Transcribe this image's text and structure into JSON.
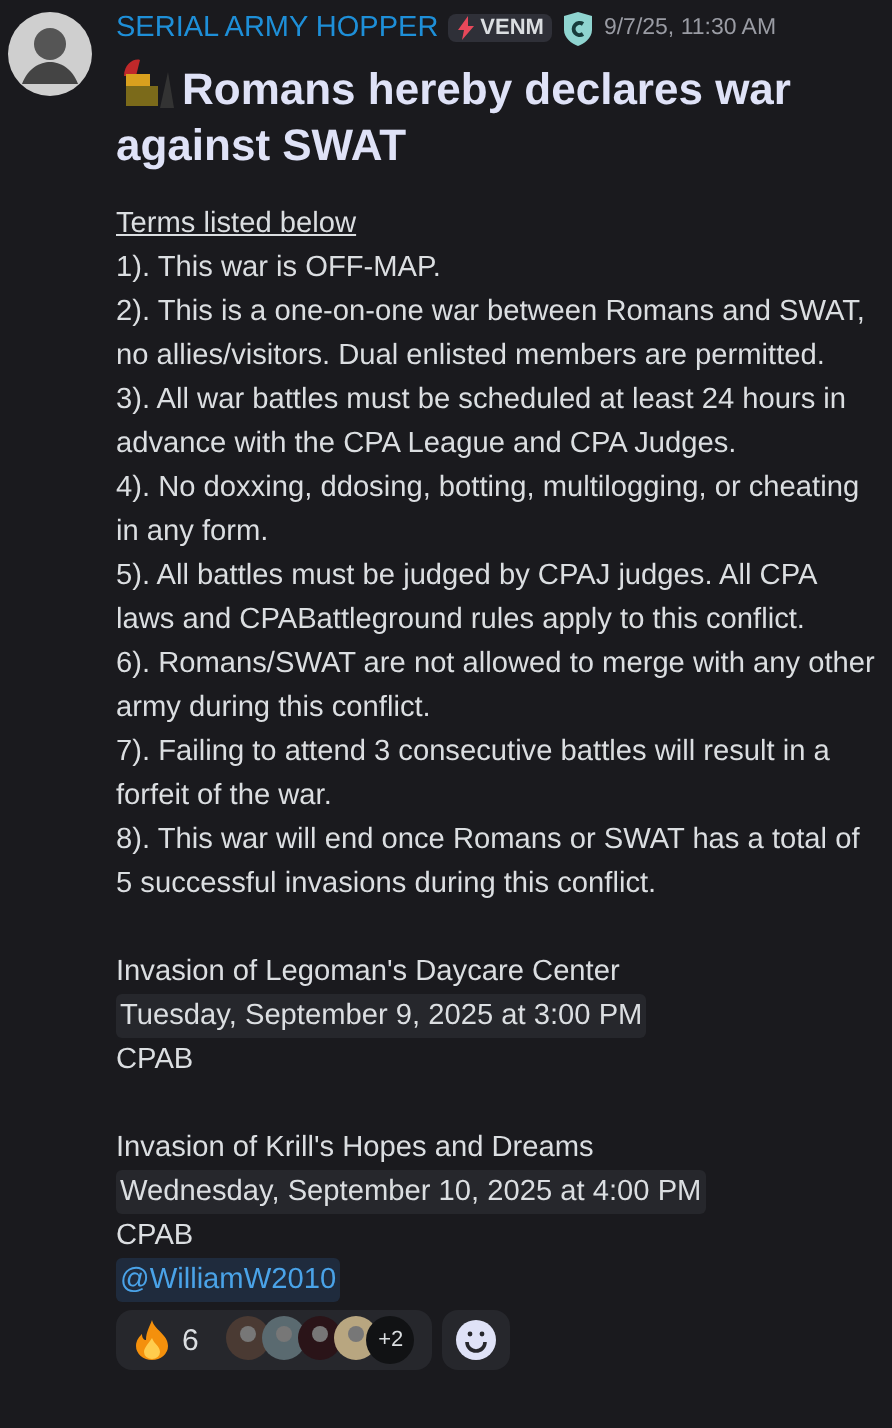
{
  "message": {
    "author": "SERIAL ARMY HOPPER",
    "tag": "VENM",
    "timestamp": "9/7/25, 11:30 AM",
    "title": "Romans hereby declares war against SWAT",
    "terms_heading": "Terms listed below",
    "terms": [
      "1). This war is OFF-MAP.",
      "2). This is a one-on-one war between Romans and SWAT, no allies/visitors. Dual enlisted members are permitted.",
      "3). All war battles must be scheduled at least 24 hours in advance with the CPA League and CPA Judges.",
      "4). No doxxing, ddosing, botting, multilogging, or cheating in any form.",
      "5). All battles must be judged by CPAJ judges. All CPA laws and CPABattleground rules apply to this conflict.",
      "6). Romans/SWAT are not allowed to merge with any other army during this conflict.",
      "7). Failing to attend 3 consecutive battles will result in a forfeit of the war.",
      "8). This war will end once Romans or SWAT has a total of 5 successful invasions during this conflict."
    ],
    "events": [
      {
        "name": "Invasion of Legoman's Daycare Center",
        "date": "Tuesday, September 9, 2025 at 3:00 PM",
        "place": "CPAB"
      },
      {
        "name": "Invasion of Krill's Hopes and Dreams",
        "date": "Wednesday, September 10, 2025 at 4:00 PM",
        "place": "CPAB"
      }
    ],
    "mention": "@WilliamW2010",
    "reaction": {
      "count": "6",
      "more": "+2",
      "selected": false
    }
  }
}
